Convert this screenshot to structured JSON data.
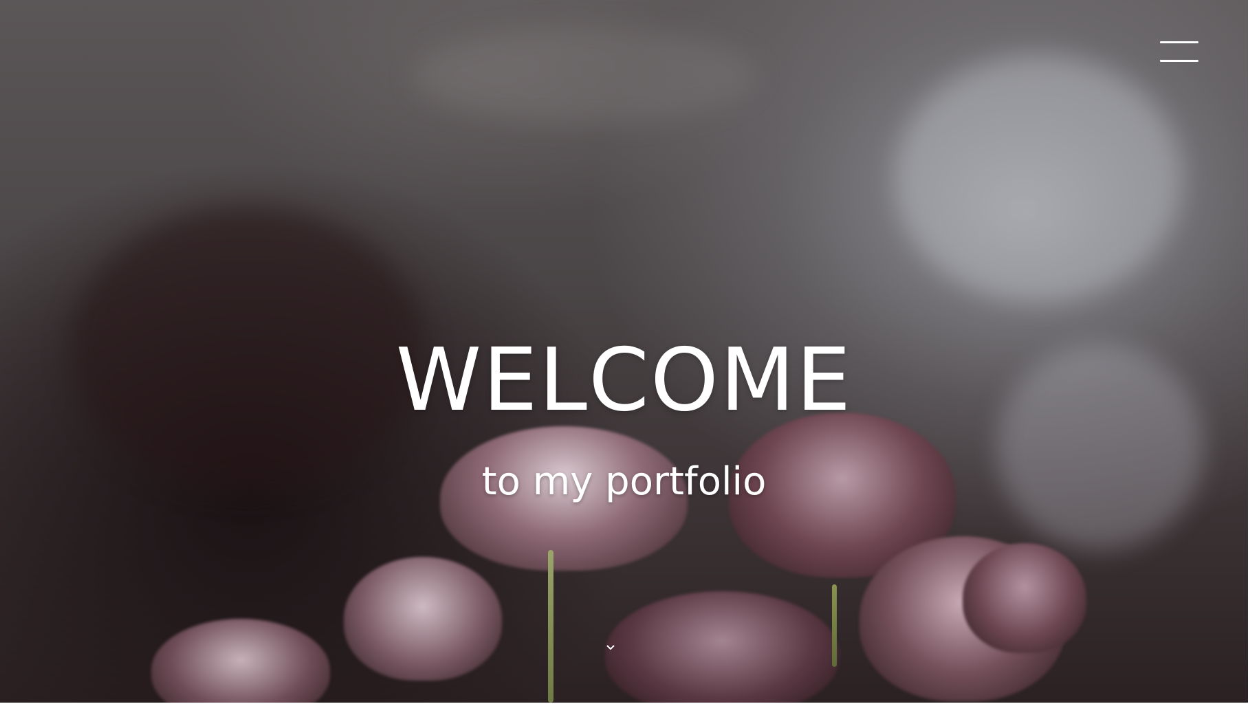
{
  "hero": {
    "title": "WELCOME",
    "subtitle": "to my portfolio",
    "background_image": "dark-tulips-on-concrete-wall"
  },
  "nav": {
    "menu_icon": "hamburger-menu-icon"
  },
  "scroll": {
    "icon": "chevron-down-icon"
  },
  "colors": {
    "text": "#ffffff",
    "background_dark": "#2b2123",
    "background_light": "#c8ccd6",
    "petal": "#8a6a74"
  }
}
